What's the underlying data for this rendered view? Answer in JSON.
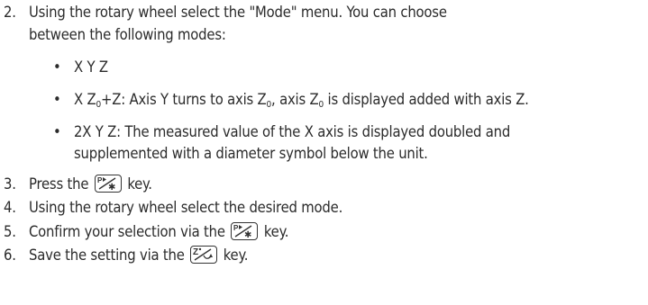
{
  "steps": [
    {
      "num": "2.",
      "lines": [
        "Using the rotary wheel select the \"Mode\" menu. You can choose",
        "between the following modes:"
      ]
    },
    {
      "num": "3.",
      "before": "Press the",
      "after": "key.",
      "key": "p-star-key"
    },
    {
      "num": "4.",
      "text": "Using the rotary wheel select the desired mode."
    },
    {
      "num": "5.",
      "before": "Confirm your selection via the",
      "after": "key.",
      "key": "p-star-key"
    },
    {
      "num": "6.",
      "before": "Save the setting via the",
      "after": "key.",
      "key": "z-arrow-key"
    }
  ],
  "modes": [
    {
      "bullet": "•",
      "text": "X Y Z"
    },
    {
      "bullet": "•",
      "text_a": "X Z",
      "sub_a": "0",
      "text_b": "+Z: Axis Y turns to axis Z",
      "sub_b": "0",
      "text_c": ", axis Z",
      "sub_c": "0",
      "text_d": " is displayed added with axis Z."
    },
    {
      "bullet": "•",
      "lines": [
        "2X Y Z: The measured value of the  X axis is displayed doubled and",
        "supplemented with a diameter symbol below the unit."
      ]
    }
  ]
}
